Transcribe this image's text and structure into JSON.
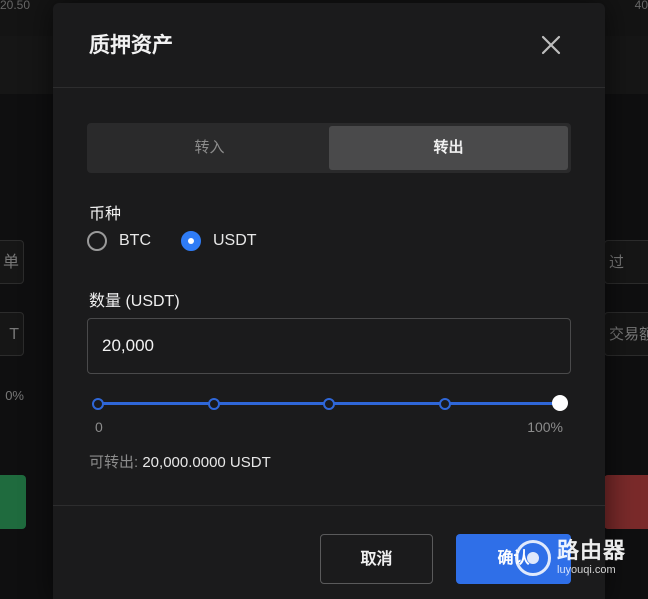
{
  "background": {
    "top_left_text": "20.50",
    "top_right_text": "40",
    "left_button_1": "单",
    "left_button_2": "T",
    "left_percent": "0%",
    "right_button_1": "过",
    "right_button_2": "交易额"
  },
  "dialog": {
    "title": "质押资产",
    "tabs": [
      {
        "label": "转入",
        "active": false
      },
      {
        "label": "转出",
        "active": true
      }
    ],
    "currency": {
      "label": "币种",
      "options": [
        {
          "label": "BTC",
          "checked": false
        },
        {
          "label": "USDT",
          "checked": true
        }
      ]
    },
    "amount": {
      "label": "数量 (USDT)",
      "value": "20,000"
    },
    "slider": {
      "min_label": "0",
      "max_label": "100%",
      "value_percent": 100,
      "marks": [
        0,
        25,
        50,
        75,
        100
      ]
    },
    "available": {
      "label": "可转出:",
      "value": "20,000.0000 USDT"
    },
    "buttons": {
      "cancel": "取消",
      "confirm": "确认"
    }
  },
  "watermark": {
    "cn": "路由器",
    "en": "luyouqi.com"
  },
  "colors": {
    "accent": "#2f6fe8",
    "dialog_bg": "#1b1b1c"
  }
}
